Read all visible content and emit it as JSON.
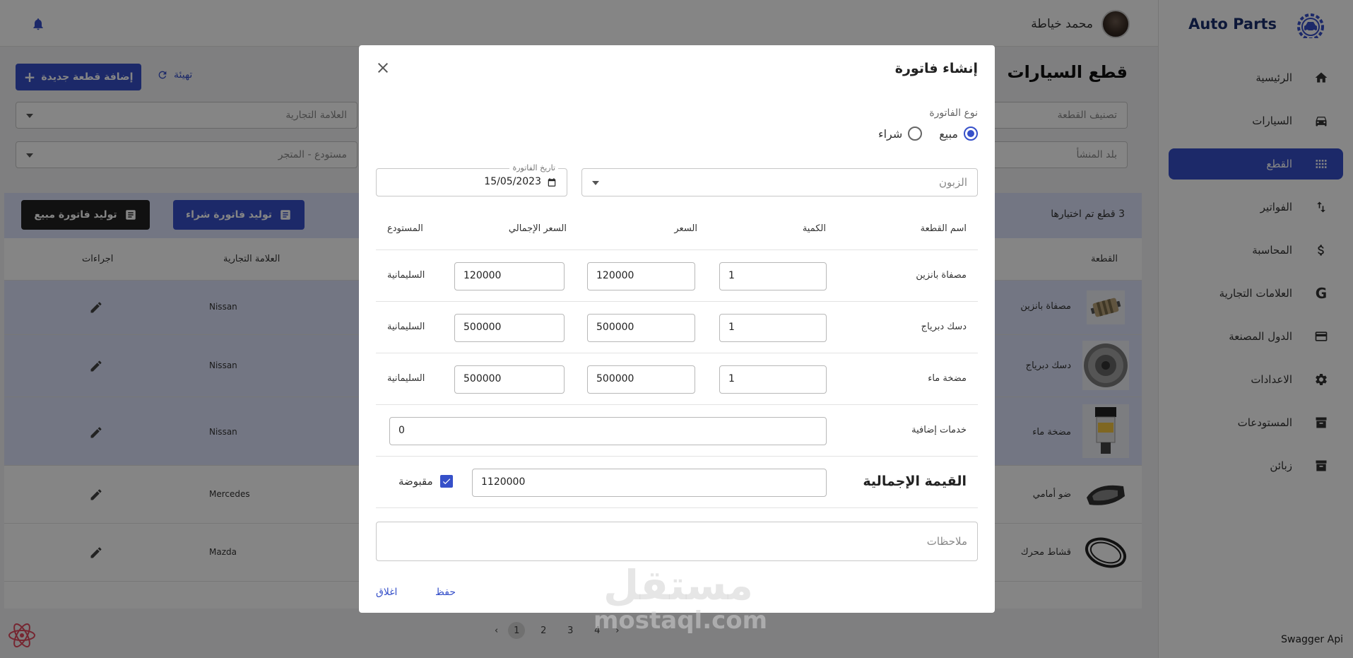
{
  "brand": {
    "name": "Auto Parts"
  },
  "user": {
    "name": "محمد خياطة"
  },
  "sidebar": {
    "items": [
      {
        "label": "الرئيسية",
        "icon": "home-icon"
      },
      {
        "label": "السيارات",
        "icon": "car-icon"
      },
      {
        "label": "القطع",
        "icon": "grid-icon",
        "active": true
      },
      {
        "label": "الفواتير",
        "icon": "swap-icon"
      },
      {
        "label": "المحاسبة",
        "icon": "dollar-icon"
      },
      {
        "label": "العلامات التجارية",
        "icon": "brand-g-icon"
      },
      {
        "label": "الدول المصنعة",
        "icon": "flag-card-icon"
      },
      {
        "label": "الاعدادات",
        "icon": "gear-icon"
      },
      {
        "label": "المستودعات",
        "icon": "archive-icon"
      },
      {
        "label": "زبائن",
        "icon": "archive-icon"
      }
    ],
    "footer": "Swagger Api"
  },
  "page": {
    "title": "قطع السيارات",
    "add_button": "إضافة قطعة جديدة",
    "reset_button": "تهيئة",
    "filters": {
      "category": "تصنيف القطعة",
      "brand": "العلامة التجارية",
      "origin": "بلد المنشأ",
      "warehouse": "مستودع - المتجر"
    },
    "selection": {
      "text": "3 قطع تم اختيارها",
      "purchase_invoice": "توليد فاتورة شراء",
      "sale_invoice": "توليد فاتورة مبيع"
    },
    "table": {
      "col_part": "القطعة",
      "col_brand": "العلامة التجارية",
      "col_actions": "اجراءات",
      "rows": [
        {
          "name": "مصفاة بانزين",
          "brand": "Nissan"
        },
        {
          "name": "دسك دبرياج",
          "brand": "Nissan"
        },
        {
          "name": "مضخة ماء",
          "brand": "Nissan"
        },
        {
          "name": "ضو أمامي",
          "brand": "Mercedes"
        },
        {
          "name": "قشاط محرك",
          "brand": "Mazda"
        }
      ]
    },
    "pagination": {
      "pages": [
        "1",
        "2",
        "3",
        "4"
      ],
      "current": "1"
    }
  },
  "modal": {
    "title": "إنشاء فاتورة",
    "invoice_type_label": "نوع الفاتورة",
    "type_sale": "مبيع",
    "type_purchase": "شراء",
    "selected_type": "مبيع",
    "customer_placeholder": "الزبون",
    "date_label": "تاريخ الفاتورة",
    "date_value": "15/05/2023",
    "columns": {
      "name": "اسم القطعة",
      "qty": "الكمية",
      "price": "السعر",
      "total": "السعر الإجمالي",
      "warehouse": "المستودع"
    },
    "rows": [
      {
        "name": "مصفاة بانزين",
        "qty": "1",
        "price": "120000",
        "total": "120000",
        "warehouse": "السليمانية"
      },
      {
        "name": "دسك دبرياج",
        "qty": "1",
        "price": "500000",
        "total": "500000",
        "warehouse": "السليمانية"
      },
      {
        "name": "مضخة ماء",
        "qty": "1",
        "price": "500000",
        "total": "500000",
        "warehouse": "السليمانية"
      }
    ],
    "extra_services_label": "خدمات إضافية",
    "extra_services_value": "0",
    "total_label": "القيمة الإجمالية",
    "total_value": "1120000",
    "paid_label": "مقبوضة",
    "paid_checked": true,
    "notes_placeholder": "ملاحظات",
    "save_button": "حفظ",
    "close_button": "اغلاق"
  },
  "watermark": {
    "line1": "مستقل",
    "line2": "mostaql.com"
  },
  "colors": {
    "primary": "#3650c9",
    "selected_row": "#dce3fb",
    "dark_button": "#222222"
  }
}
